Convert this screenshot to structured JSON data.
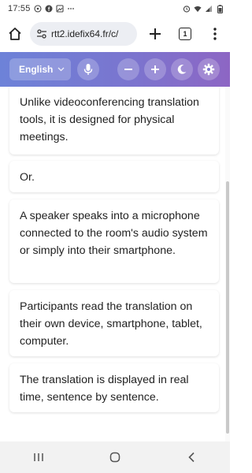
{
  "status_bar": {
    "time": "17:55",
    "left_icons": [
      "whatsapp-icon",
      "facebook-icon",
      "image-icon",
      "more-notifications-icon"
    ],
    "right_icons": [
      "alarm-icon",
      "wifi-icon",
      "signal-icon",
      "battery-icon"
    ]
  },
  "browser": {
    "url": "rtt2.idefix64.fr/c/",
    "tab_count": "1"
  },
  "toolbar": {
    "language": "English",
    "accent_gradient": [
      "#6d82d8",
      "#8d66c4"
    ]
  },
  "messages": [
    "Unlike videoconferencing translation tools, it is designed for physical meetings.",
    "Or.",
    "A speaker speaks into a microphone connected to the room's audio system or simply into their smartphone.",
    "Participants read the translation on their own device, smartphone, tablet, computer.",
    "The translation is displayed in real time, sentence by sentence."
  ]
}
